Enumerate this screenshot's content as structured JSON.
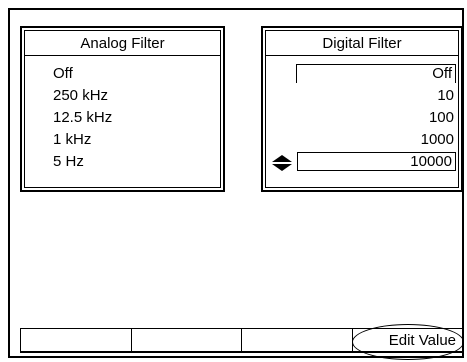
{
  "analog_filter": {
    "title": "Analog Filter",
    "options": [
      "Off",
      "250 kHz",
      "12.5 kHz",
      "1 kHz",
      "5 Hz"
    ]
  },
  "digital_filter": {
    "title": "Digital Filter",
    "options": [
      "Off",
      "10",
      "100",
      "1000",
      "10000"
    ],
    "selected_index": 4
  },
  "softkeys": [
    "",
    "",
    "",
    "Edit Value"
  ],
  "icons": {
    "stepper": "up-down-arrows-icon"
  }
}
